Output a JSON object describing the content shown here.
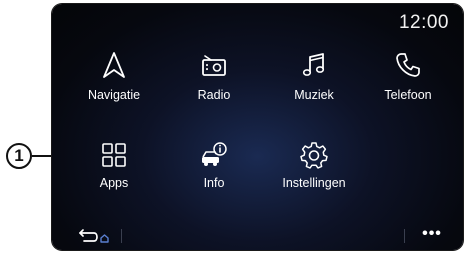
{
  "clock": "12:00",
  "callout": "1",
  "tiles": [
    {
      "label": "Navigatie",
      "icon": "navigation-arrow-icon"
    },
    {
      "label": "Radio",
      "icon": "radio-icon"
    },
    {
      "label": "Muziek",
      "icon": "music-note-icon"
    },
    {
      "label": "Telefoon",
      "icon": "phone-icon"
    },
    {
      "label": "Apps",
      "icon": "apps-grid-icon"
    },
    {
      "label": "Info",
      "icon": "vehicle-info-icon"
    },
    {
      "label": "Instellingen",
      "icon": "settings-gear-icon"
    }
  ],
  "bottom_bar": {
    "back_icon": "back-home-icon",
    "more_label": "•••"
  },
  "colors": {
    "screen_bg": "#06080f",
    "icon_stroke": "#ffffff",
    "text": "#ffffff",
    "info_accent": "#ffffff"
  }
}
